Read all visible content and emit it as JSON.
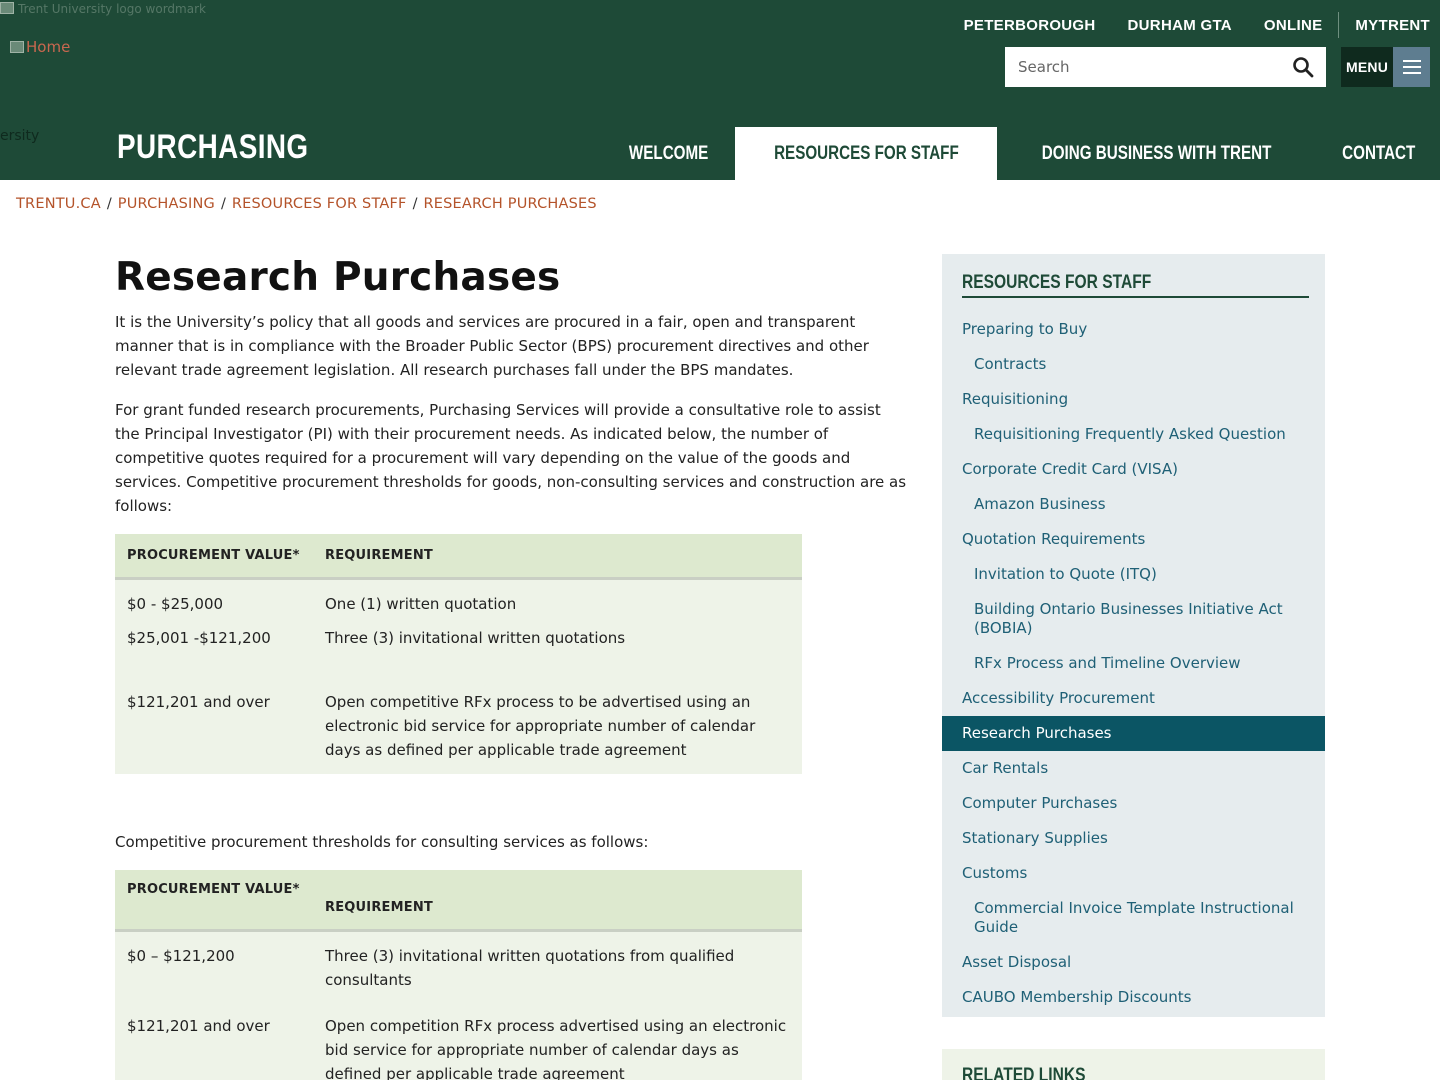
{
  "header": {
    "broken_top_alt": "Trent University logo wordmark",
    "home_alt": "Home",
    "broken_university_text": "ersity",
    "top_links": [
      "PETERBOROUGH",
      "DURHAM GTA",
      "ONLINE",
      "MYTRENT"
    ],
    "search": {
      "placeholder": "Search"
    },
    "menu_label": "MENU",
    "site_title": "PURCHASING",
    "main_nav": [
      {
        "label": "WELCOME",
        "active": false
      },
      {
        "label": "RESOURCES FOR STAFF",
        "active": true
      },
      {
        "label": "DOING BUSINESS WITH TRENT",
        "active": false
      },
      {
        "label": "CONTACT",
        "active": false
      }
    ],
    "colors": {
      "brand_green": "#1e4a37",
      "link_orange": "#b4532a",
      "sidebar_link": "#1f6076",
      "active_teal": "#0b5564"
    }
  },
  "breadcrumb": [
    "TRENTU.CA",
    "PURCHASING",
    "RESOURCES FOR STAFF",
    "RESEARCH PURCHASES"
  ],
  "main": {
    "title": "Research Purchases",
    "para1": "It is the University’s policy that all goods and services are procured in a fair, open and transparent manner that is in compliance with the Broader Public Sector (BPS) procurement directives and other relevant trade agreement legislation.  All research purchases fall under the BPS mandates.",
    "para2": "For grant funded research procurements, Purchasing Services will provide a consultative role to assist the Principal Investigator (PI) with their procurement needs.  As indicated below, the number of competitive quotes required for a procurement will vary depending on the value of the goods and services. Competitive procurement thresholds for goods, non-consulting services and construction are as follows:",
    "table1": {
      "headers": [
        "PROCUREMENT VALUE*",
        "REQUIREMENT"
      ],
      "rows": [
        [
          "$0 - $25,000",
          "One (1) written quotation"
        ],
        [
          "$25,001 -$121,200",
          "Three (3) invitational written quotations"
        ],
        [
          "$121,201 and over",
          "Open competitive RFx process to be advertised using an electronic bid service for appropriate number of calendar days as defined per applicable trade agreement"
        ]
      ]
    },
    "para3": "Competitive procurement thresholds for consulting services as follows:",
    "table2": {
      "headers": [
        "PROCUREMENT VALUE*",
        "REQUIREMENT"
      ],
      "rows": [
        [
          "$0 – $121,200",
          "Three (3) invitational written quotations from qualified consultants"
        ],
        [
          "$121,201 and over",
          "Open competition RFx process advertised using an electronic bid service for appropriate number of calendar days as defined per applicable trade agreement"
        ]
      ]
    }
  },
  "sidebar": {
    "heading": "RESOURCES FOR STAFF",
    "items": [
      {
        "label": "Preparing to Buy",
        "level": 1
      },
      {
        "label": "Contracts",
        "level": 2
      },
      {
        "label": "Requisitioning",
        "level": 1
      },
      {
        "label": "Requisitioning Frequently Asked Question",
        "level": 2
      },
      {
        "label": "Corporate Credit Card (VISA)",
        "level": 1
      },
      {
        "label": "Amazon Business",
        "level": 2
      },
      {
        "label": "Quotation Requirements",
        "level": 1
      },
      {
        "label": "Invitation to Quote (ITQ)",
        "level": 2
      },
      {
        "label": "Building Ontario Businesses Initiative Act (BOBIA)",
        "level": 2
      },
      {
        "label": "RFx Process and Timeline Overview",
        "level": 2
      },
      {
        "label": "Accessibility Procurement",
        "level": 1
      },
      {
        "label": "Research Purchases",
        "level": 1,
        "active": true
      },
      {
        "label": "Car Rentals",
        "level": 1
      },
      {
        "label": "Computer Purchases",
        "level": 1
      },
      {
        "label": "Stationary Supplies",
        "level": 1
      },
      {
        "label": "Customs",
        "level": 1
      },
      {
        "label": "Commercial Invoice Template Instructional Guide",
        "level": 2
      },
      {
        "label": "Asset Disposal",
        "level": 1
      },
      {
        "label": "CAUBO Membership Discounts",
        "level": 1
      }
    ],
    "related_heading": "RELATED LINKS"
  }
}
